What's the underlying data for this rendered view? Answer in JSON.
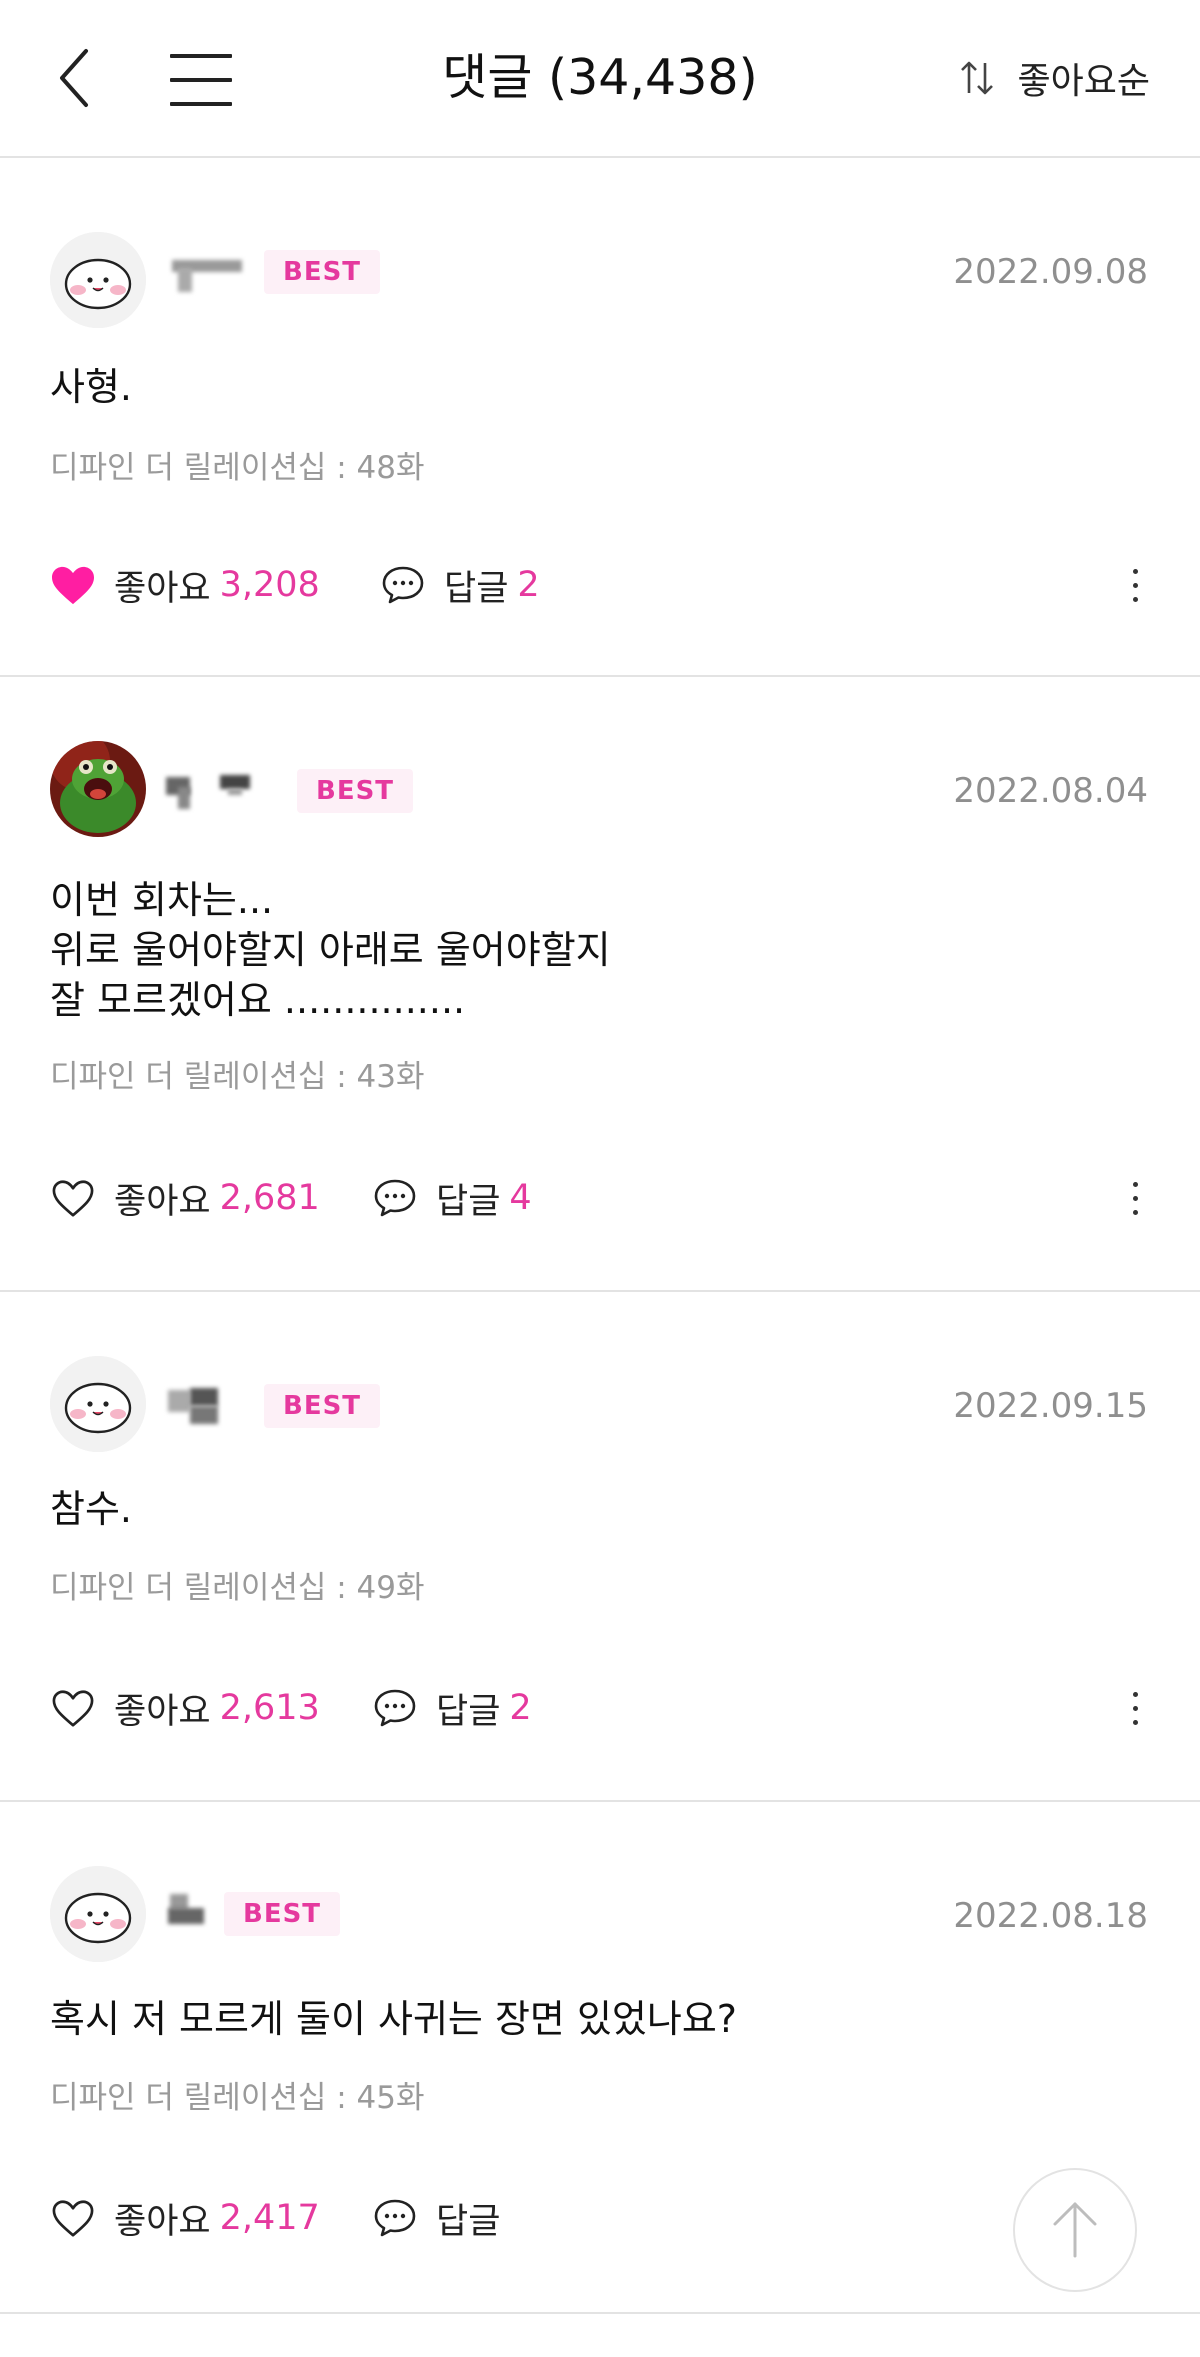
{
  "header": {
    "title": "댓글 (34,438)",
    "sort_label": "좋아요순"
  },
  "comments": [
    {
      "badge": "BEST",
      "date": "2022.09.08",
      "text": "사형.",
      "episode": "디파인 더 릴레이션십 : 48화",
      "like_label": "좋아요",
      "like_count": "3,208",
      "liked": true,
      "reply_label": "답글",
      "reply_count": "2"
    },
    {
      "badge": "BEST",
      "date": "2022.08.04",
      "text": "이번 회차는...\n위로 울어야할지 아래로 울어야할지\n잘 모르겠어요 ...............",
      "episode": "디파인 더 릴레이션십 : 43화",
      "like_label": "좋아요",
      "like_count": "2,681",
      "liked": false,
      "reply_label": "답글",
      "reply_count": "4"
    },
    {
      "badge": "BEST",
      "date": "2022.09.15",
      "text": "참수.",
      "episode": "디파인 더 릴레이션십 : 49화",
      "like_label": "좋아요",
      "like_count": "2,613",
      "liked": false,
      "reply_label": "답글",
      "reply_count": "2"
    },
    {
      "badge": "BEST",
      "date": "2022.08.18",
      "text": "혹시 저 모르게 둘이 사귀는 장면 있었나요?",
      "episode": "디파인 더 릴레이션십 : 45화",
      "like_label": "좋아요",
      "like_count": "2,417",
      "liked": false,
      "reply_label": "답글",
      "reply_count": ""
    }
  ],
  "colors": {
    "accent": "#e5399e",
    "badge_bg": "#fdf0f7",
    "divider": "#e3e3e3",
    "muted": "#8f8f8f"
  }
}
